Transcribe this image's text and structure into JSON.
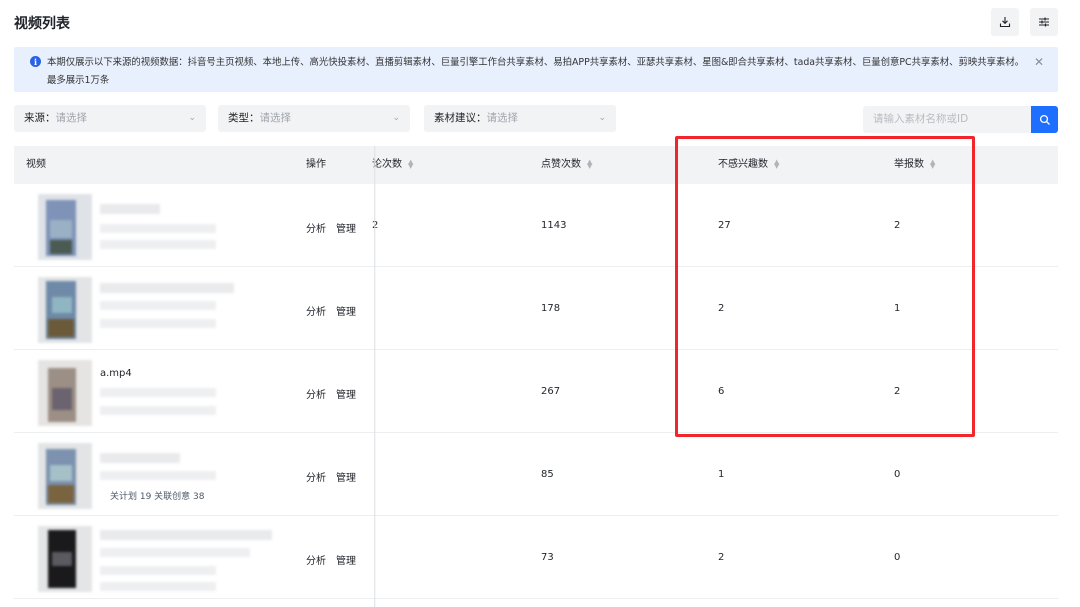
{
  "header": {
    "title": "视频列表"
  },
  "toolbar": {
    "download_icon": "download-icon",
    "settings_icon": "sliders-icon"
  },
  "notice": {
    "text": "本期仅展示以下来源的视频数据：抖音号主页视频、本地上传、高光快投素材、直播剪辑素材、巨量引擎工作台共享素材、易拍APP共享素材、亚瑟共享素材、星图&即合共享素材、tada共享素材、巨量创意PC共享素材、剪映共享素材。最多展示1万条",
    "close_icon": "close-icon"
  },
  "filters": [
    {
      "label": "来源：",
      "placeholder": "请选择"
    },
    {
      "label": "类型：",
      "placeholder": "请选择"
    },
    {
      "label": "素材建议：",
      "placeholder": "请选择"
    }
  ],
  "search": {
    "placeholder": "请输入素材名称或ID"
  },
  "table": {
    "columns": {
      "video": "视频",
      "ops": "操作",
      "comments": "论次数",
      "likes": "点赞次数",
      "dislikes": "不感兴趣数",
      "reports": "举报数"
    },
    "op_labels": {
      "analyze": "分析",
      "manage": "管理"
    },
    "rows": [
      {
        "name": "",
        "meta": "",
        "comments_partial": "2",
        "likes": "1143",
        "dislikes": "27",
        "reports": "2"
      },
      {
        "name": "",
        "meta": "",
        "comments_partial": "",
        "likes": "178",
        "dislikes": "2",
        "reports": "1"
      },
      {
        "name": "a.mp4",
        "meta": "",
        "comments_partial": "",
        "likes": "267",
        "dislikes": "6",
        "reports": "2"
      },
      {
        "name": "",
        "meta": "关计划 19  关联创意 38",
        "comments_partial": "",
        "likes": "85",
        "dislikes": "1",
        "reports": "0"
      },
      {
        "name": "",
        "meta": "",
        "comments_partial": "",
        "likes": "73",
        "dislikes": "2",
        "reports": "0"
      }
    ]
  },
  "colors": {
    "accent": "#1e6fff",
    "highlight_box": "#f0262a",
    "notice_bg": "#e8f0fe"
  }
}
